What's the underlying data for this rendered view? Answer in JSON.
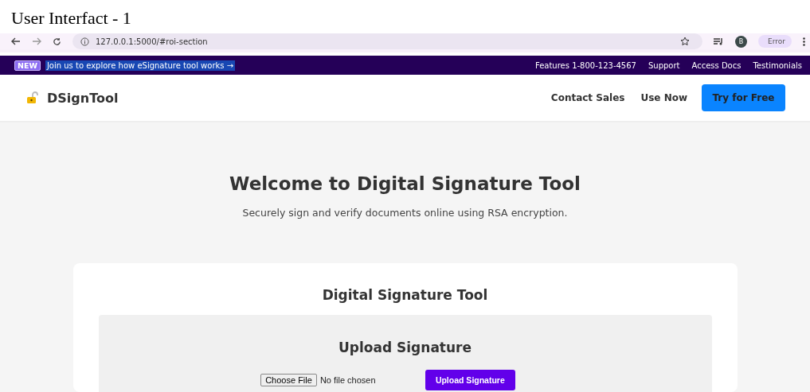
{
  "caption": "User Interfact - 1",
  "browser": {
    "url": "127.0.0.1:5000/#roi-section",
    "avatar": "B",
    "status": "Error"
  },
  "banner": {
    "badge": "NEW",
    "message": "Join us to explore how eSignature tool works →",
    "links": [
      "Features 1-800-123-4567",
      "Support",
      "Access Docs",
      "Testimonials"
    ]
  },
  "navbar": {
    "brand": "DSignTool",
    "links": [
      "Contact Sales",
      "Use Now"
    ],
    "cta": "Try for Free"
  },
  "hero": {
    "title": "Welcome to Digital Signature Tool",
    "subtitle": "Securely sign and verify documents online using RSA encryption."
  },
  "card": {
    "title": "Digital Signature Tool",
    "section": {
      "title": "Upload Signature",
      "file_button": "Choose File",
      "file_status": "No file chosen",
      "submit": "Upload Signature"
    }
  }
}
